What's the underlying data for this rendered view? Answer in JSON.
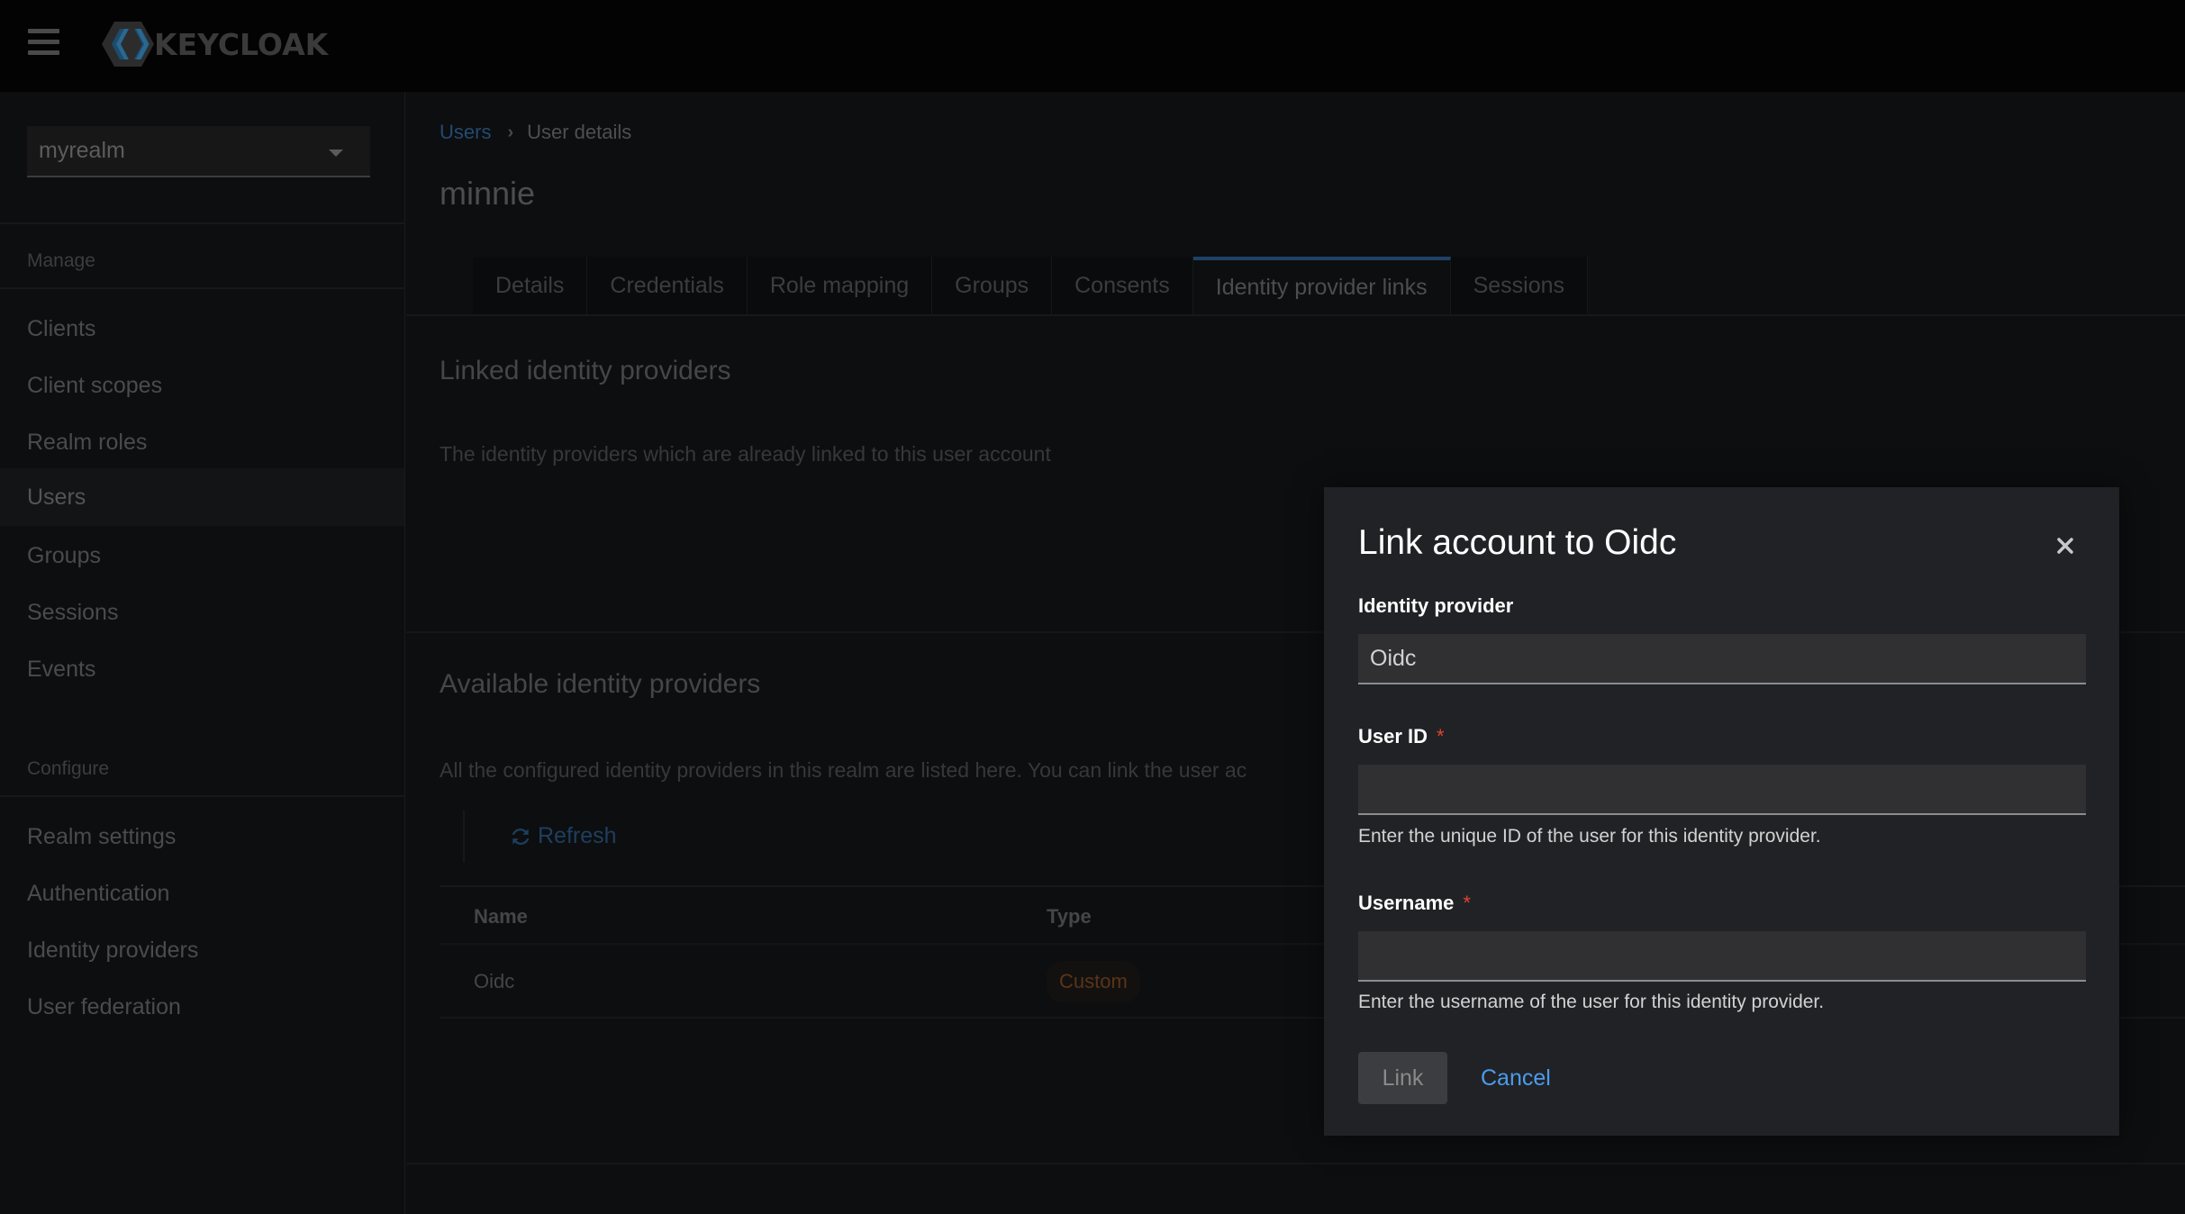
{
  "header": {
    "brand": "KEYCLOAK",
    "menu_icon": "hamburger-menu-icon",
    "logo_icon": "keycloak-logo-icon"
  },
  "sidebar": {
    "realm_select": {
      "value": "myrealm",
      "icon": "caret-down-icon"
    },
    "groups": [
      {
        "title": "Manage",
        "items": [
          {
            "label": "Clients"
          },
          {
            "label": "Client scopes"
          },
          {
            "label": "Realm roles"
          },
          {
            "label": "Users",
            "active": true
          },
          {
            "label": "Groups"
          },
          {
            "label": "Sessions"
          },
          {
            "label": "Events"
          }
        ]
      },
      {
        "title": "Configure",
        "items": [
          {
            "label": "Realm settings"
          },
          {
            "label": "Authentication"
          },
          {
            "label": "Identity providers"
          },
          {
            "label": "User federation"
          }
        ]
      }
    ]
  },
  "main": {
    "breadcrumb": [
      {
        "label": "Users",
        "link": true
      },
      {
        "label": "User details",
        "link": false
      }
    ],
    "page_title": "minnie",
    "tabs": [
      {
        "label": "Details"
      },
      {
        "label": "Credentials"
      },
      {
        "label": "Role mapping"
      },
      {
        "label": "Groups"
      },
      {
        "label": "Consents"
      },
      {
        "label": "Identity provider links",
        "active": true
      },
      {
        "label": "Sessions"
      }
    ],
    "linked_section": {
      "title": "Linked identity providers",
      "description": "The identity providers which are already linked to this user account"
    },
    "available_section": {
      "title": "Available identity providers",
      "description": "All the configured identity providers in this realm are listed here. You can link the user ac",
      "refresh_label": "Refresh",
      "refresh_icon": "sync-icon",
      "table": {
        "columns": [
          "Name",
          "Type"
        ],
        "rows": [
          {
            "name": "Oidc",
            "type": "Custom"
          }
        ]
      }
    }
  },
  "modal": {
    "title": "Link account to Oidc",
    "close_icon": "close-icon",
    "fields": {
      "identity_provider": {
        "label": "Identity provider",
        "value": "Oidc",
        "required": false
      },
      "user_id": {
        "label": "User ID",
        "value": "",
        "required": true,
        "required_marker": "*",
        "helper": "Enter the unique ID of the user for this identity provider."
      },
      "username": {
        "label": "Username",
        "value": "",
        "required": true,
        "required_marker": "*",
        "helper": "Enter the username of the user for this identity provider."
      }
    },
    "link_label": "Link",
    "cancel_label": "Cancel"
  },
  "colors": {
    "accent": "#4a9ceb",
    "required": "#e3442f",
    "badge_text": "#5a3418",
    "active_tab_border": "#1f4266"
  }
}
